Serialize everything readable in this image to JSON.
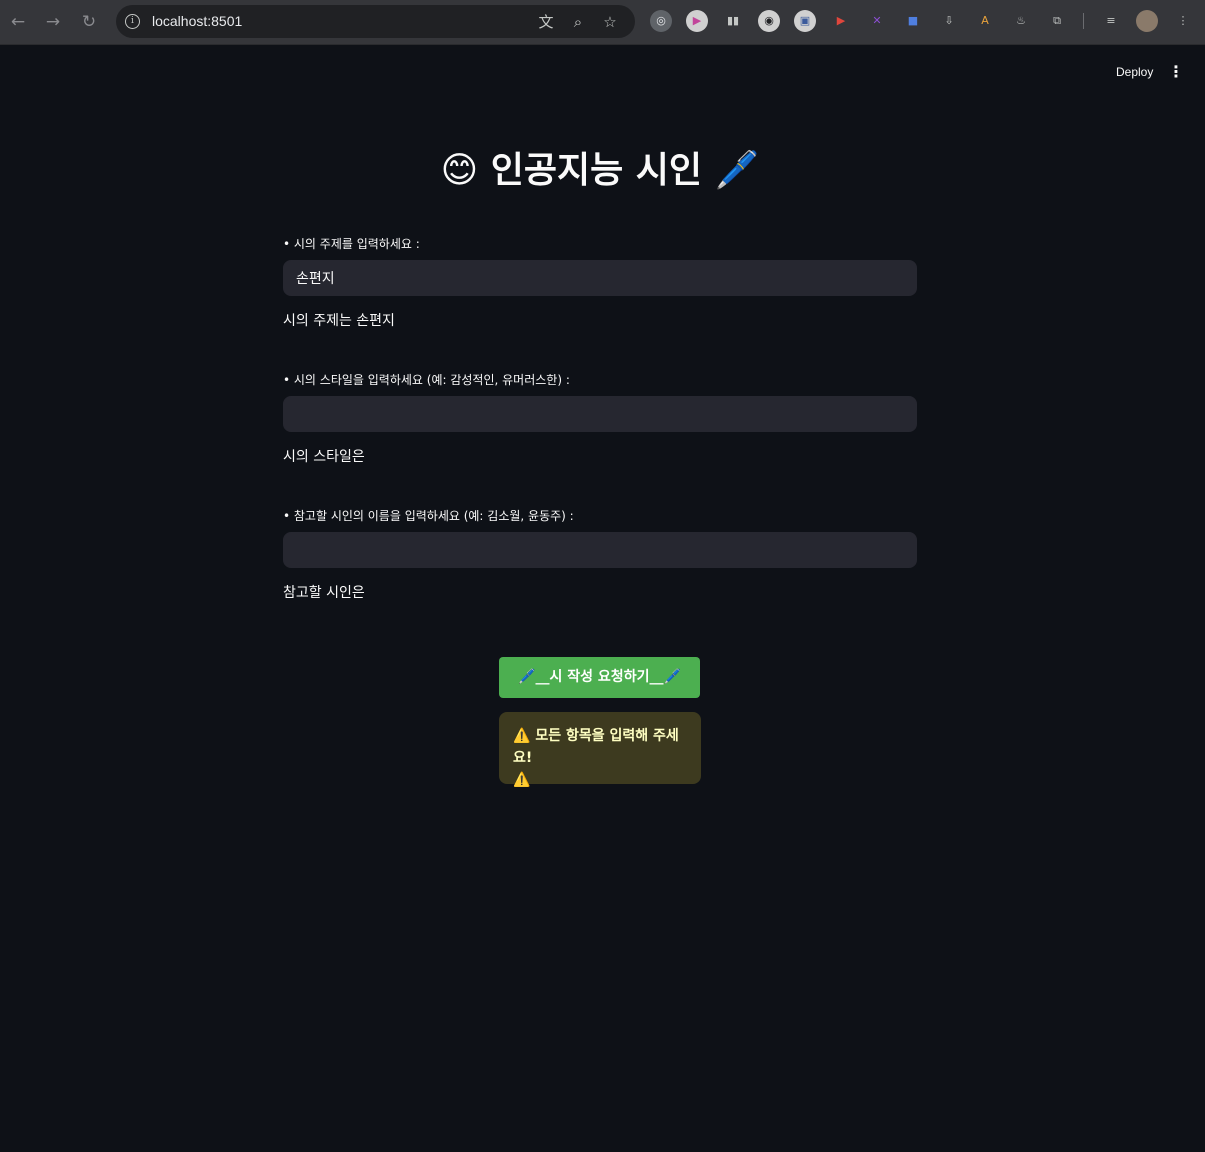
{
  "browser": {
    "url": "localhost:8501",
    "back_icon": "←",
    "forward_icon": "→",
    "reload_icon": "↻",
    "extensions": [
      "◎",
      "▶",
      "▮▮",
      "◉",
      "▣",
      "▶",
      "✕",
      "■",
      "⇩",
      "A",
      "♨",
      "⧉",
      "≡",
      "●",
      "⋮"
    ]
  },
  "app": {
    "deploy_label": "Deploy",
    "menu_icon": "⋮"
  },
  "main": {
    "title": "😊 인공지능 시인 🖊️",
    "topic": {
      "label": "• 시의 주제를 입력하세요 :",
      "value": "손편지",
      "echo": "시의 주제는 손편지"
    },
    "style": {
      "label": "• 시의 스타일을 입력하세요 (예: 감성적인, 유머러스한) :",
      "value": "",
      "echo": "시의 스타일은"
    },
    "poet": {
      "label": "• 참고할 시인의 이름을 입력하세요 (예: 김소월, 윤동주) :",
      "value": "",
      "echo": "참고할 시인은"
    },
    "submit_label": "🖊️__시 작성 요청하기__🖊️",
    "warning": {
      "icon": "⚠️",
      "text": "모든 항목을 입력해 주세요!",
      "trailing_icon": "⚠️"
    }
  },
  "colors": {
    "background": "#0e1117",
    "input_bg": "#262730",
    "button": "#4caf50",
    "warning_bg": "#3d3a1f",
    "warning_text": "#ffffc2"
  }
}
